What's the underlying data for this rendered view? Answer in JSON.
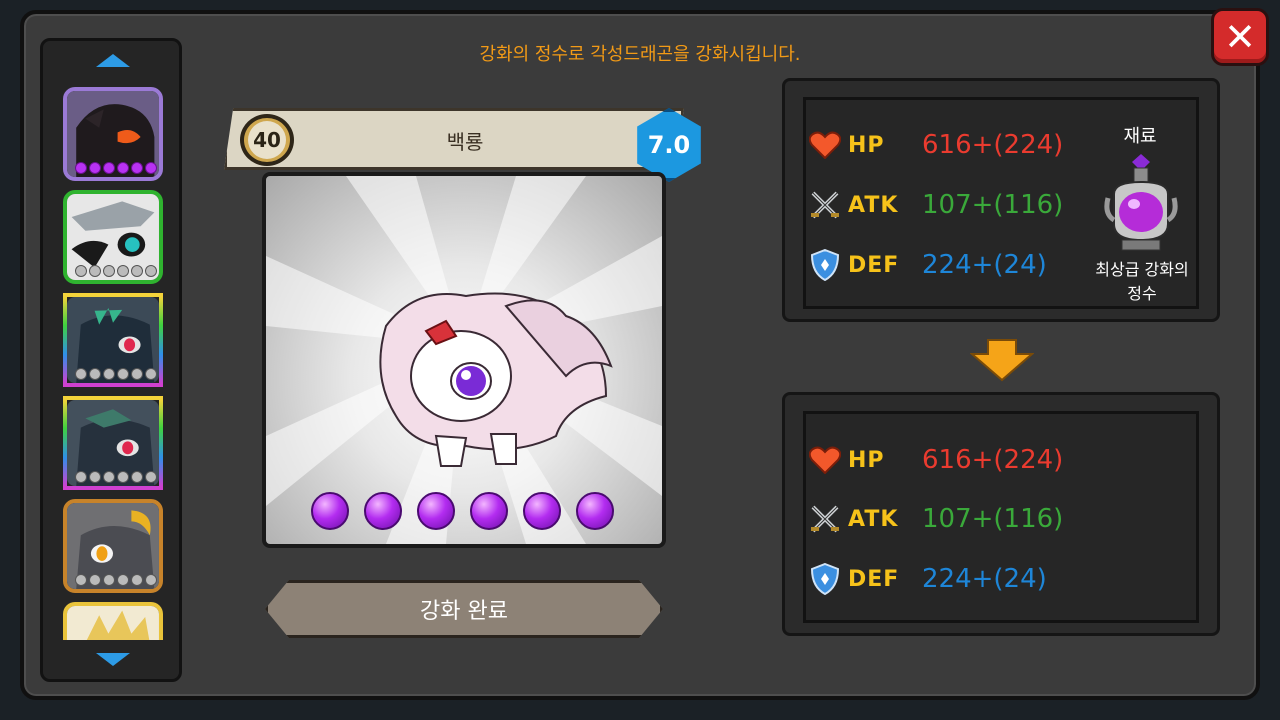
{
  "title": "강화의 정수로 각성드래곤을 강화시킵니다.",
  "close_icon": "close-x-icon",
  "sidebar": {
    "up_icon": "arrow-up-icon",
    "down_icon": "arrow-down-icon",
    "dragons": [
      {
        "name": "dragon-slot-1",
        "border": "#9b7ad6",
        "orbs_filled": 6
      },
      {
        "name": "dragon-slot-2",
        "border": "#2fb32f",
        "orbs_filled": 0
      },
      {
        "name": "dragon-slot-3",
        "border": "rainbow",
        "orbs_filled": 0
      },
      {
        "name": "dragon-slot-4",
        "border": "rainbow",
        "orbs_filled": 0
      },
      {
        "name": "dragon-slot-5",
        "border": "#c7832a",
        "orbs_filled": 0
      },
      {
        "name": "dragon-slot-6",
        "border": "#e9c33a",
        "orbs_filled": 0
      }
    ]
  },
  "dragon": {
    "level": "40",
    "name": "백룡",
    "grade": "7.0",
    "orbs": 6
  },
  "button": {
    "complete_label": "강화 완료"
  },
  "current_stats": {
    "hp_label": "HP",
    "hp_value": "616+(224)",
    "atk_label": "ATK",
    "atk_value": "107+(116)",
    "def_label": "DEF",
    "def_value": "224+(24)"
  },
  "material": {
    "label": "재료",
    "name_line1": "최상급 강화의",
    "name_line2": "정수"
  },
  "result_stats": {
    "hp_label": "HP",
    "hp_value": "616+(224)",
    "atk_label": "ATK",
    "atk_value": "107+(116)",
    "def_label": "DEF",
    "def_value": "224+(24)"
  },
  "colors": {
    "title": "#f29a16",
    "hp": "#ea3b2f",
    "atk": "#3aa93a",
    "def": "#1e86d8",
    "stat_label": "#f6c21a",
    "orb": "#b32cf0"
  }
}
